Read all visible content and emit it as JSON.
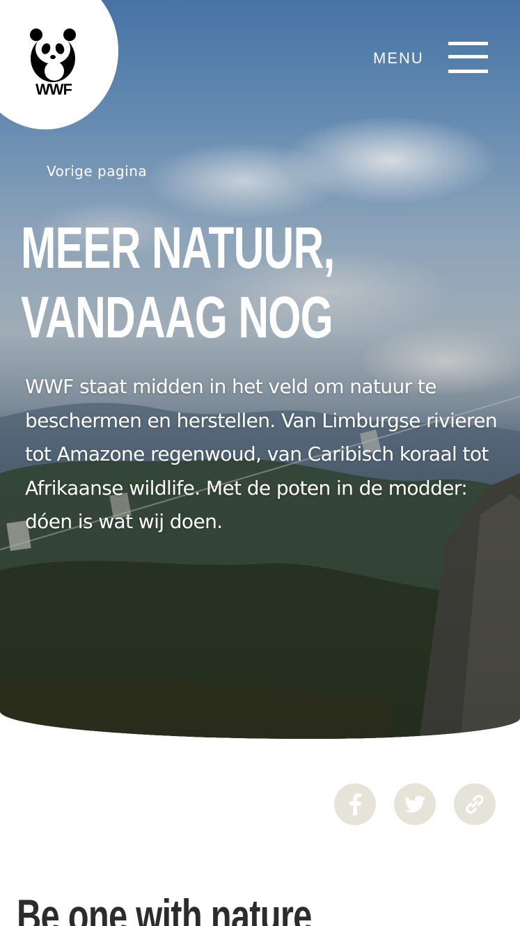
{
  "brand": {
    "logo_text": "WWF",
    "logo_icon": "panda-icon"
  },
  "header": {
    "menu_label": "MENU",
    "menu_icon": "hamburger-icon"
  },
  "hero": {
    "back_link": "Vorige pagina",
    "title_line1": "MEER NATUUR,",
    "title_line2": "VANDAAG NOG",
    "intro": "WWF staat midden in het veld om natuur te beschermen en herstellen. Van Limburgse rivieren tot Amazone regenwoud, van Caribisch koraal tot Afrikaanse wildlife. Met de poten in de modder: dóen is wat wij doen."
  },
  "share": {
    "buttons": [
      {
        "icon": "facebook-icon"
      },
      {
        "icon": "twitter-icon"
      },
      {
        "icon": "link-icon"
      }
    ],
    "color": "#e6e3d8"
  },
  "section": {
    "heading": "Be one with nature"
  }
}
